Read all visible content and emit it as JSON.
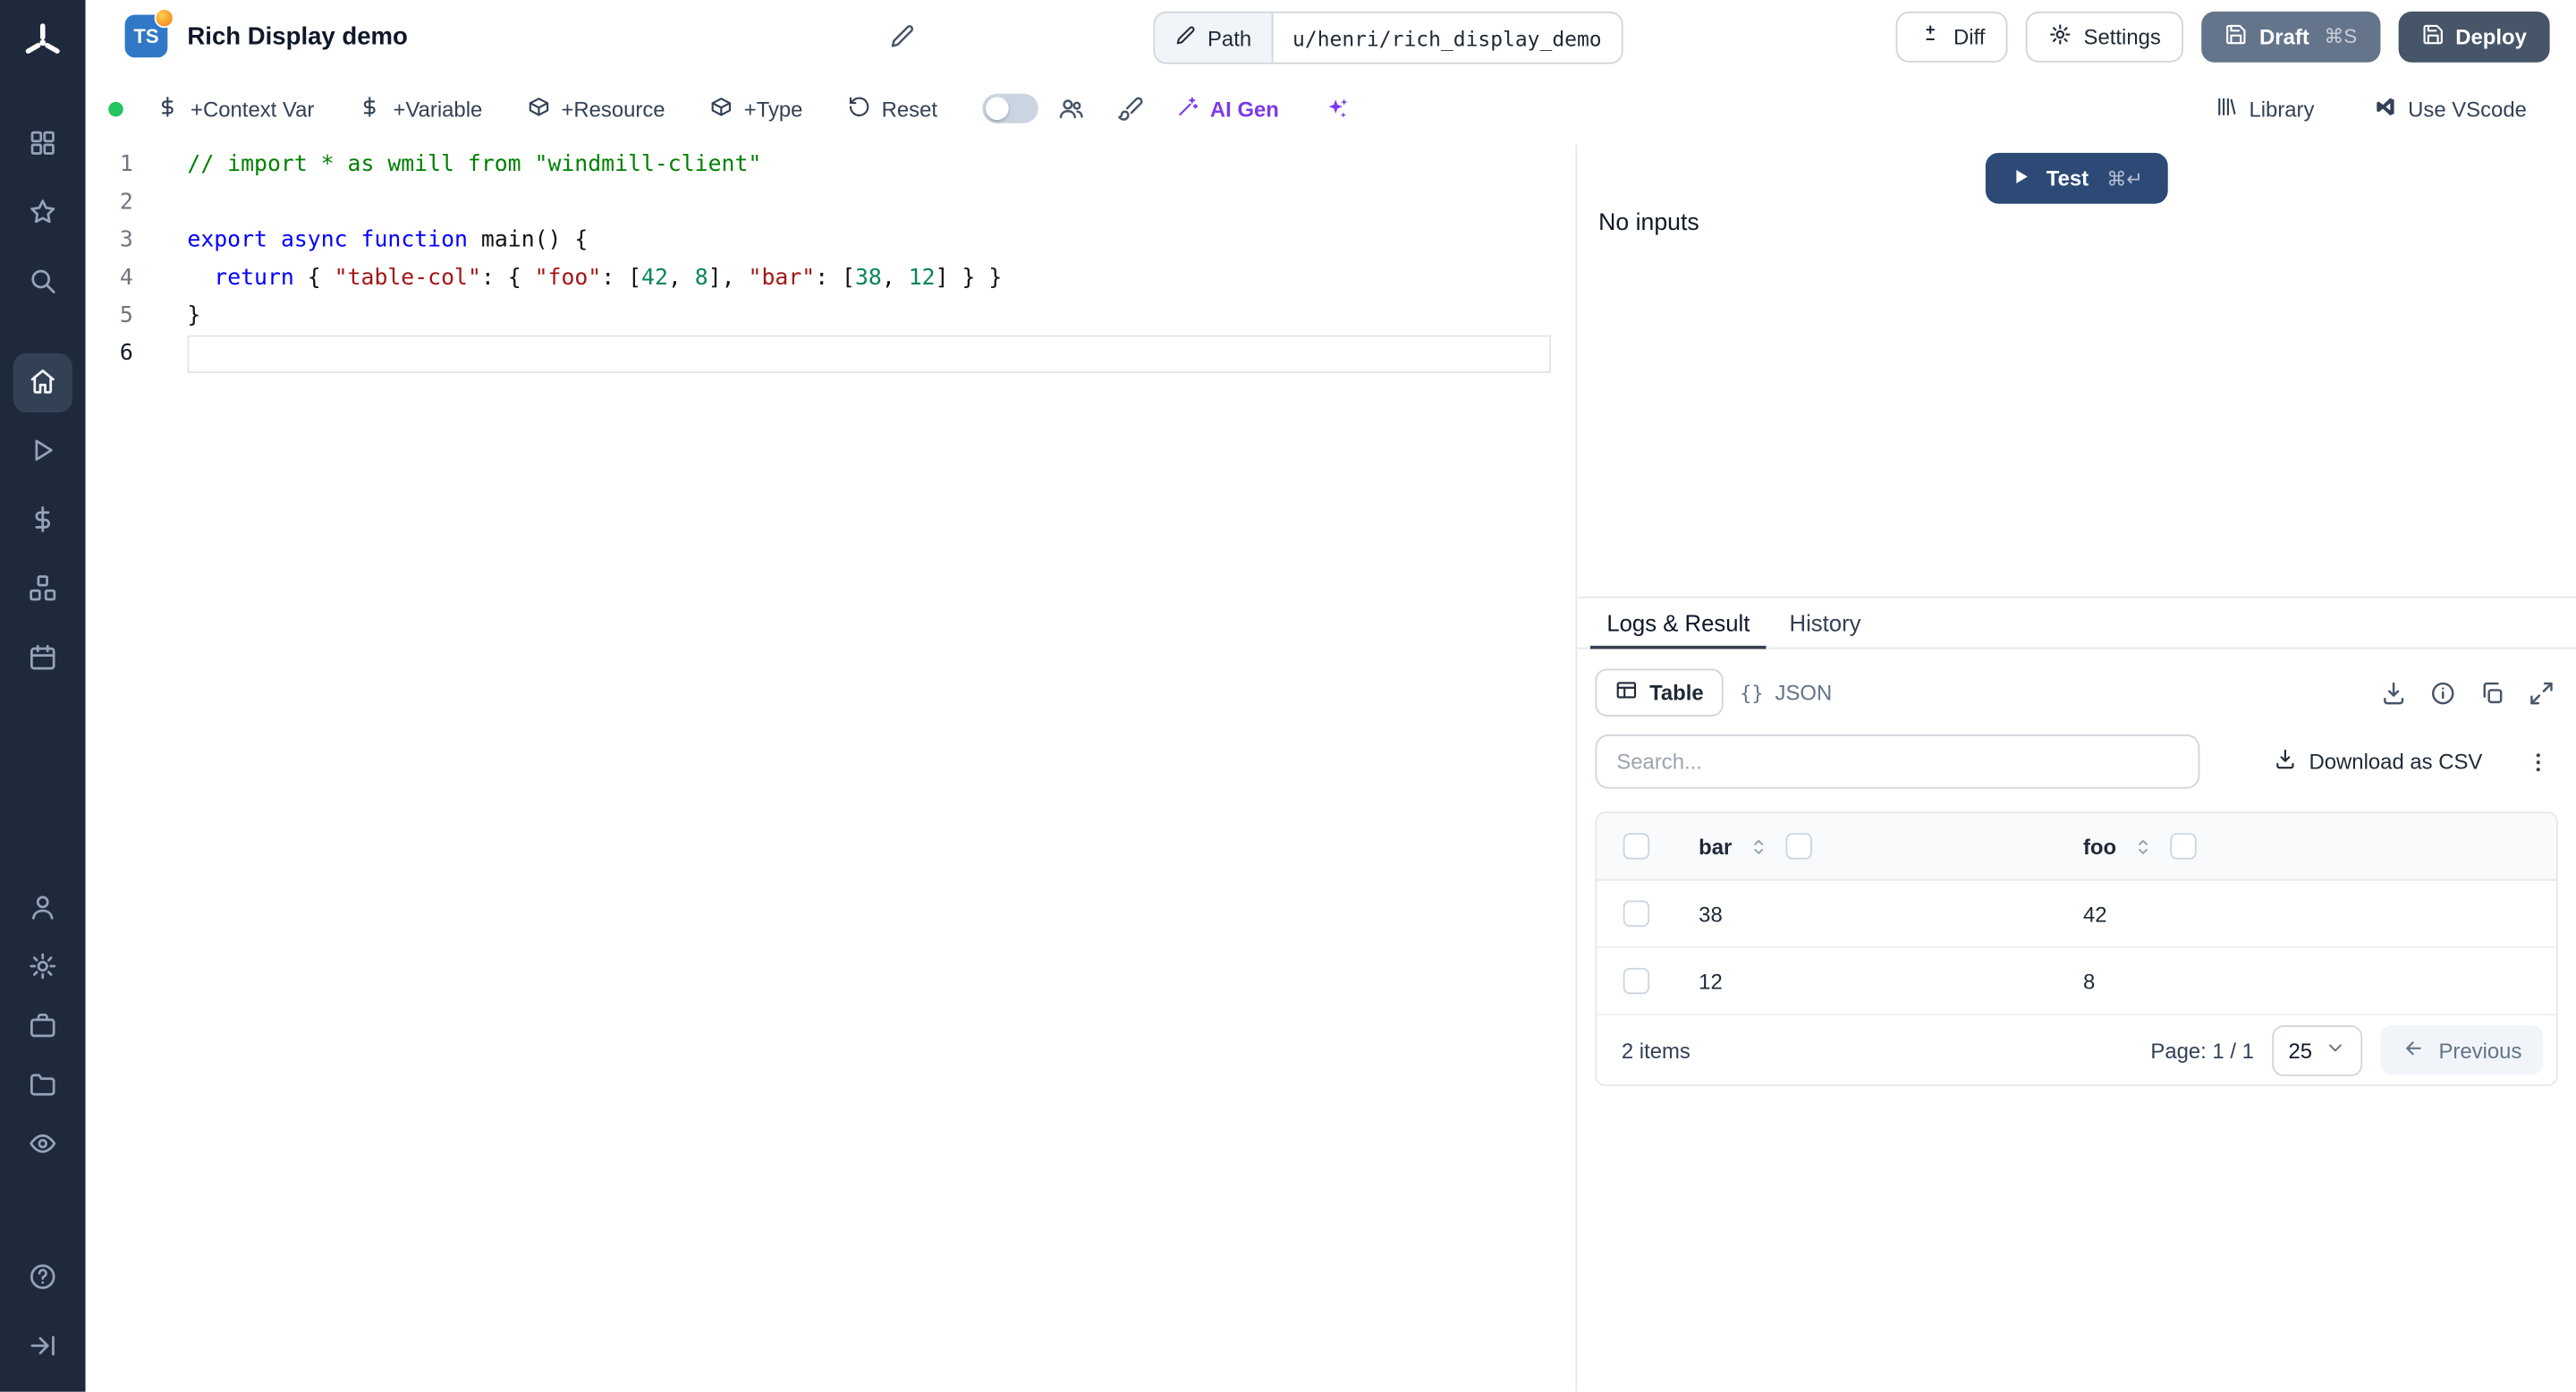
{
  "colors": {
    "sidebar_bg": "#1e293b",
    "accent_test": "#2d4a77",
    "draft_btn": "#64748b",
    "deploy_btn": "#475569",
    "ts_badge": "#3178c6",
    "ai_violet": "#7c3aed",
    "status_green": "#22c55e"
  },
  "header": {
    "badge": "TS",
    "title": "Rich Display demo",
    "path_label": "Path",
    "path_value": "u/henri/rich_display_demo",
    "diff_label": "Diff",
    "settings_label": "Settings",
    "draft_label": "Draft",
    "draft_shortcut": "⌘S",
    "deploy_label": "Deploy"
  },
  "toolbar": {
    "context_var": "+Context Var",
    "variable": "+Variable",
    "resource": "+Resource",
    "type": "+Type",
    "reset": "Reset",
    "ai_gen": "AI Gen",
    "library": "Library",
    "vscode": "Use VScode"
  },
  "editor": {
    "active_line": "6",
    "lines": [
      {
        "no": "1",
        "tokens": [
          [
            "// import * as wmill from \"windmill-client\"",
            "tk-comment"
          ]
        ]
      },
      {
        "no": "2",
        "tokens": []
      },
      {
        "no": "3",
        "tokens": [
          [
            "export",
            "tk-kw"
          ],
          [
            " ",
            ""
          ],
          [
            "async",
            "tk-kw"
          ],
          [
            " ",
            ""
          ],
          [
            "function",
            "tk-kw"
          ],
          [
            " main() {",
            ""
          ]
        ]
      },
      {
        "no": "4",
        "tokens": [
          [
            "  ",
            ""
          ],
          [
            "return",
            "tk-kw"
          ],
          [
            " { ",
            ""
          ],
          [
            "\"table-col\"",
            "tk-str"
          ],
          [
            ": { ",
            ""
          ],
          [
            "\"foo\"",
            "tk-str"
          ],
          [
            ": [",
            ""
          ],
          [
            "42",
            "tk-num"
          ],
          [
            ", ",
            ""
          ],
          [
            "8",
            "tk-num"
          ],
          [
            "], ",
            ""
          ],
          [
            "\"bar\"",
            "tk-str"
          ],
          [
            ": [",
            ""
          ],
          [
            "38",
            "tk-num"
          ],
          [
            ", ",
            ""
          ],
          [
            "12",
            "tk-num"
          ],
          [
            "] } }",
            ""
          ]
        ]
      },
      {
        "no": "5",
        "tokens": [
          [
            "}",
            ""
          ]
        ]
      },
      {
        "no": "6",
        "tokens": []
      }
    ]
  },
  "run_panel": {
    "test_label": "Test",
    "test_shortcut": "⌘↵",
    "no_inputs": "No inputs"
  },
  "result_panel": {
    "tabs": [
      {
        "label": "Logs & Result"
      },
      {
        "label": "History"
      }
    ],
    "view_table": "Table",
    "view_json": "JSON",
    "json_glyph": "{}",
    "search_placeholder": "Search...",
    "download_csv": "Download as CSV",
    "table": {
      "columns": [
        "bar",
        "foo"
      ],
      "rows": [
        [
          "38",
          "42"
        ],
        [
          "12",
          "8"
        ]
      ]
    },
    "items_text": "2 items",
    "page_text": "Page: 1 / 1",
    "page_size": "25",
    "previous_label": "Previous"
  }
}
